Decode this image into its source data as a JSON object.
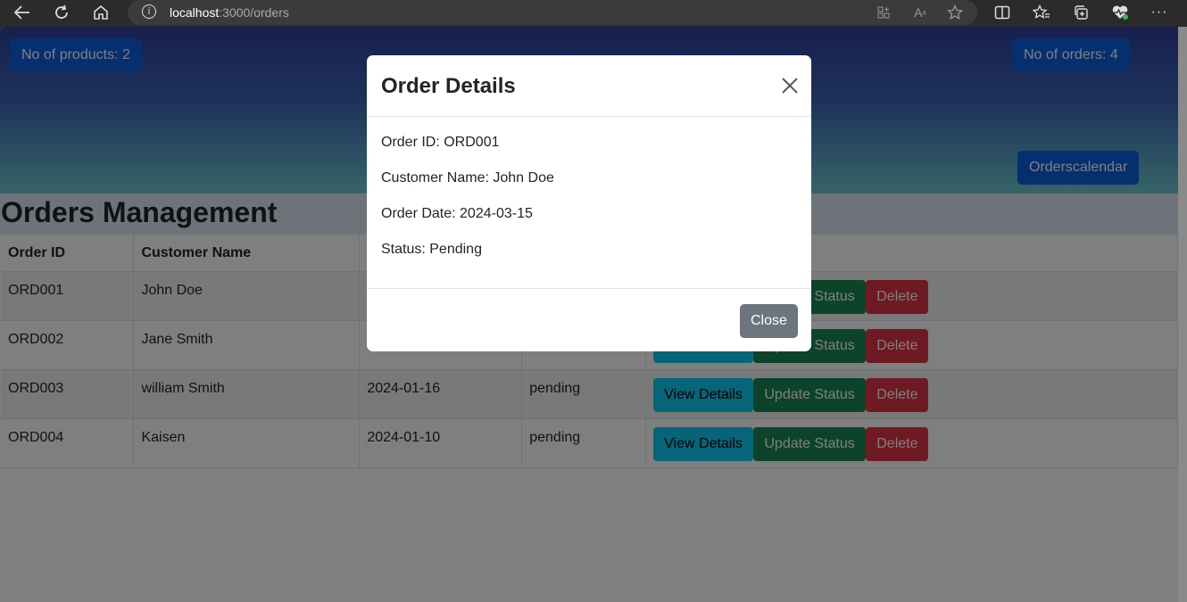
{
  "browser": {
    "url_host": "localhost",
    "url_path": ":3000/orders"
  },
  "hero": {
    "products_badge": "No of products: 2",
    "orders_badge": "No of orders: 4",
    "calendar_button": "Orderscalendar"
  },
  "page": {
    "title": "Orders Management"
  },
  "table": {
    "headers": [
      "Order ID",
      "Customer Name",
      "",
      "",
      ""
    ],
    "rows": [
      {
        "id": "ORD001",
        "customer": "John Doe",
        "date": "",
        "status": ""
      },
      {
        "id": "ORD002",
        "customer": "Jane Smith",
        "date": "",
        "status": ""
      },
      {
        "id": "ORD003",
        "customer": "william Smith",
        "date": "2024-01-16",
        "status": "pending"
      },
      {
        "id": "ORD004",
        "customer": "Kaisen",
        "date": "2024-01-10",
        "status": "pending"
      }
    ],
    "actions": {
      "view": "View Details",
      "update": "Update Status",
      "delete": "Delete"
    }
  },
  "modal": {
    "title": "Order Details",
    "order_id": "Order ID: ORD001",
    "customer_name": "Customer Name: John Doe",
    "order_date": "Order Date: 2024-03-15",
    "status": "Status: Pending",
    "close_label": "Close"
  },
  "colors": {
    "primary": "#0d6efd",
    "info": "#0dcaf0",
    "success": "#198754",
    "danger": "#dc3545",
    "secondary": "#6c757d"
  }
}
